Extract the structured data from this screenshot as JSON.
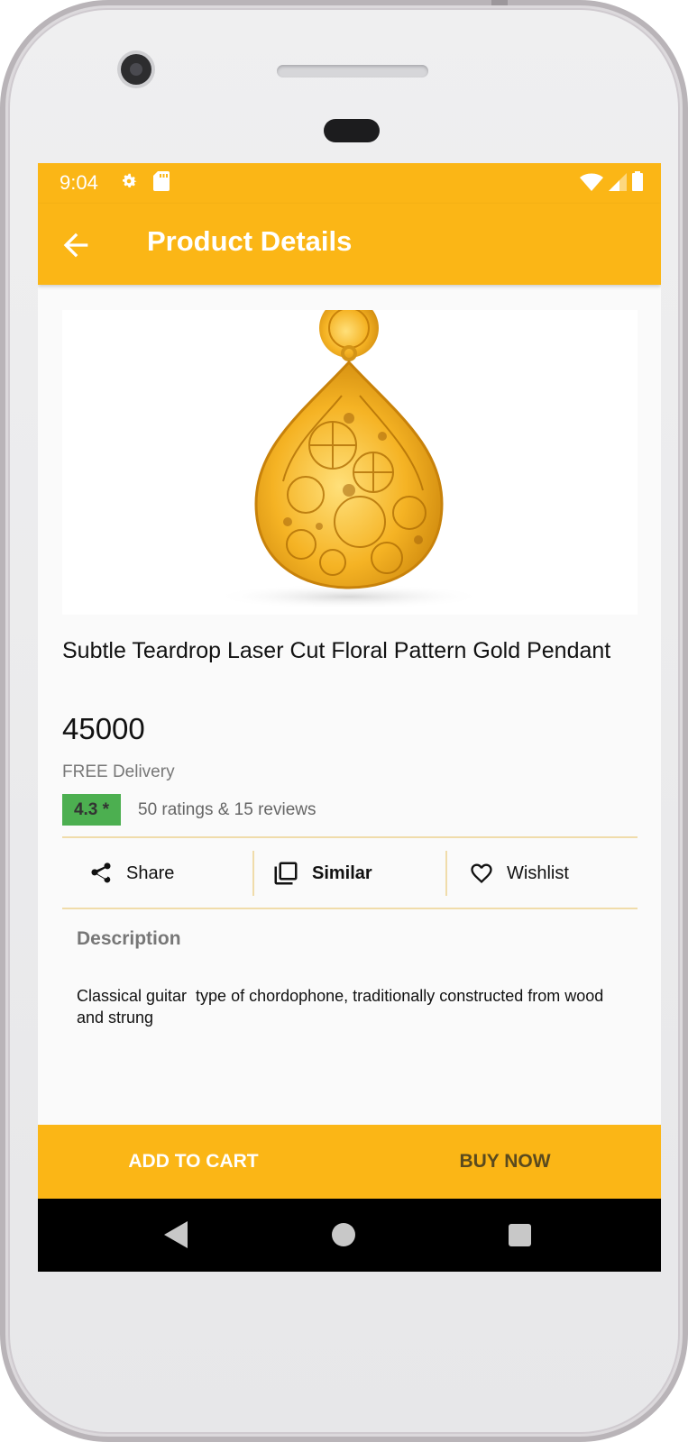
{
  "status_bar": {
    "time": "9:04",
    "icons": [
      "settings-gear-icon",
      "sd-card-icon",
      "wifi-icon",
      "signal-icon",
      "battery-icon"
    ]
  },
  "app_bar": {
    "title": "Product Details",
    "back_icon": "arrow-left-icon"
  },
  "product": {
    "image_subject": "gold teardrop pendant",
    "title": "Subtle Teardrop Laser Cut Floral Pattern Gold Pendant",
    "price": "45000",
    "delivery": "FREE Delivery",
    "rating": "4.3 *",
    "rating_summary": "50 ratings & 15 reviews"
  },
  "actions": {
    "share": "Share",
    "similar": "Similar",
    "wishlist": "Wishlist"
  },
  "description": {
    "heading": "Description",
    "text": "Classical guitar  type of chordophone, traditionally constructed from wood and strung"
  },
  "bottom": {
    "add_to_cart": "ADD TO CART",
    "buy_now": "BUY NOW"
  },
  "colors": {
    "accent": "#fbb616",
    "rating_badge": "#4caf50",
    "divider": "#f0dcaa"
  }
}
